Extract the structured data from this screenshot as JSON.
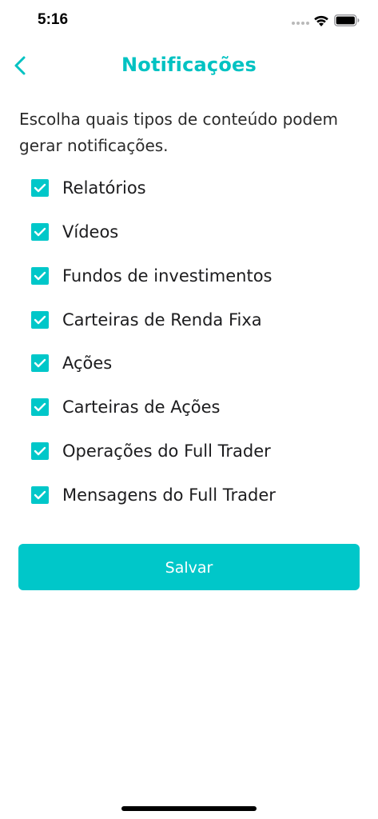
{
  "status_bar": {
    "time": "5:16"
  },
  "header": {
    "title": "Notificações",
    "back_icon": "chevron-left-icon"
  },
  "description": "Escolha quais tipos de conteúdo podem gerar notificações.",
  "options": [
    {
      "label": "Relatórios",
      "checked": true
    },
    {
      "label": "Vídeos",
      "checked": true
    },
    {
      "label": "Fundos de investimentos",
      "checked": true
    },
    {
      "label": "Carteiras de Renda Fixa",
      "checked": true
    },
    {
      "label": "Ações",
      "checked": true
    },
    {
      "label": "Carteiras de Ações",
      "checked": true
    },
    {
      "label": "Operações do Full Trader",
      "checked": true
    },
    {
      "label": "Mensagens do Full Trader",
      "checked": true
    }
  ],
  "save_button": {
    "label": "Salvar"
  },
  "colors": {
    "accent": "#00c7c9",
    "title": "#00c2c2",
    "text": "#1c1c1e"
  }
}
